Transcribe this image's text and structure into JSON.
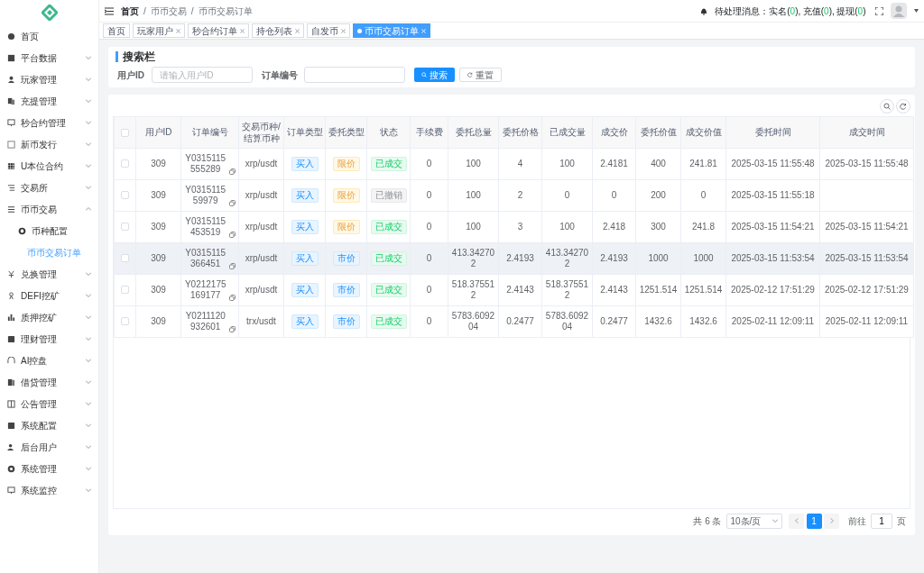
{
  "sidebar": {
    "items": [
      {
        "label": "首页",
        "has_children": false
      },
      {
        "label": "平台数据",
        "has_children": true,
        "expanded": false
      },
      {
        "label": "玩家管理",
        "has_children": true,
        "expanded": false
      },
      {
        "label": "充提管理",
        "has_children": true,
        "expanded": false
      },
      {
        "label": "秒合约管理",
        "has_children": true,
        "expanded": false
      },
      {
        "label": "新币发行",
        "has_children": true,
        "expanded": false
      },
      {
        "label": "U本位合约",
        "has_children": true,
        "expanded": false
      },
      {
        "label": "交易所",
        "has_children": true,
        "expanded": false
      },
      {
        "label": "币币交易",
        "has_children": true,
        "expanded": true,
        "children": [
          {
            "label": "币种配置",
            "selected": false,
            "icon": true
          },
          {
            "label": "币币交易订单",
            "selected": true,
            "icon": false
          }
        ]
      },
      {
        "label": "兑换管理",
        "has_children": true,
        "expanded": false
      },
      {
        "label": "DEFI挖矿",
        "has_children": true,
        "expanded": false
      },
      {
        "label": "质押挖矿",
        "has_children": true,
        "expanded": false
      },
      {
        "label": "理财管理",
        "has_children": true,
        "expanded": false
      },
      {
        "label": "AI控盘",
        "has_children": true,
        "expanded": false
      },
      {
        "label": "借贷管理",
        "has_children": true,
        "expanded": false
      },
      {
        "label": "公告管理",
        "has_children": true,
        "expanded": false
      },
      {
        "label": "系统配置",
        "has_children": true,
        "expanded": false
      },
      {
        "label": "后台用户",
        "has_children": true,
        "expanded": false
      },
      {
        "label": "系统管理",
        "has_children": true,
        "expanded": false
      },
      {
        "label": "系统监控",
        "has_children": true,
        "expanded": false
      }
    ]
  },
  "breadcrumb": {
    "separator": "/",
    "items": [
      "首页",
      "币币交易",
      "币币交易订单"
    ]
  },
  "notice": {
    "label": "待处理消息：",
    "items": [
      {
        "label": "实名(",
        "count": "0",
        "suffix": "),"
      },
      {
        "label": "充值(",
        "count": "0",
        "suffix": "),"
      },
      {
        "label": "提现(",
        "count": "0",
        "suffix": ")"
      }
    ]
  },
  "tabs": [
    {
      "label": "首页",
      "selected": false,
      "closable": false
    },
    {
      "label": "玩家用户",
      "selected": false,
      "closable": true
    },
    {
      "label": "秒合约订单",
      "selected": false,
      "closable": true
    },
    {
      "label": "持仓列表",
      "selected": false,
      "closable": true
    },
    {
      "label": "自发币",
      "selected": false,
      "closable": true
    },
    {
      "label": "币币交易订单",
      "selected": true,
      "closable": true
    }
  ],
  "search": {
    "title": "搜索栏",
    "fields": [
      {
        "label": "用户ID",
        "placeholder": "请输入用户ID"
      },
      {
        "label": "订单编号"
      }
    ],
    "search_button": "搜索",
    "reset_button": "重置"
  },
  "table": {
    "all_checked": false,
    "columns": [
      "用户ID",
      "订单编号",
      "交易币种/结算币种",
      "订单类型",
      "委托类型",
      "状态",
      "手续费",
      "委托总量",
      "委托价格",
      "已成交量",
      "成交价",
      "委托价值",
      "成交价值",
      "委托时间",
      "成交时间"
    ],
    "rows": [
      {
        "checked": false,
        "hovered": false,
        "user_id": "309",
        "order_no": "Y0315115555289",
        "pair": "xrp/usdt",
        "order_type": {
          "text": "买入",
          "kind": "buy"
        },
        "entrust_type": {
          "text": "限价",
          "kind": "limit"
        },
        "status": {
          "text": "已成交",
          "kind": "done"
        },
        "fee": "0",
        "total": "100",
        "price": "4",
        "filled": "100",
        "deal_price": "2.4181",
        "entrust_value": "400",
        "deal_value": "241.81",
        "entrust_time": "2025-03-15 11:55:48",
        "deal_time": "2025-03-15 11:55:48"
      },
      {
        "checked": false,
        "hovered": false,
        "user_id": "309",
        "order_no": "Y031511559979",
        "pair": "xrp/usdt",
        "order_type": {
          "text": "买入",
          "kind": "buy"
        },
        "entrust_type": {
          "text": "限价",
          "kind": "limit"
        },
        "status": {
          "text": "已撤销",
          "kind": "cancelled"
        },
        "fee": "0",
        "total": "100",
        "price": "2",
        "filled": "0",
        "deal_price": "0",
        "entrust_value": "200",
        "deal_value": "0",
        "entrust_time": "2025-03-15 11:55:18"
      },
      {
        "checked": false,
        "hovered": false,
        "user_id": "309",
        "order_no": "Y0315115453519",
        "pair": "xrp/usdt",
        "order_type": {
          "text": "买入",
          "kind": "buy"
        },
        "entrust_type": {
          "text": "限价",
          "kind": "limit"
        },
        "status": {
          "text": "已成交",
          "kind": "done"
        },
        "fee": "0",
        "total": "100",
        "price": "3",
        "filled": "100",
        "deal_price": "2.418",
        "entrust_value": "300",
        "deal_value": "241.8",
        "entrust_time": "2025-03-15 11:54:21",
        "deal_time": "2025-03-15 11:54:21"
      },
      {
        "checked": false,
        "hovered": true,
        "user_id": "309",
        "order_no": "Y0315115366451",
        "pair": "xrp/usdt",
        "order_type": {
          "text": "买入",
          "kind": "buy"
        },
        "entrust_type": {
          "text": "市价",
          "kind": "market"
        },
        "status": {
          "text": "已成交",
          "kind": "done"
        },
        "fee": "0",
        "total": "413.342702",
        "price": "2.4193",
        "filled": "413.342702",
        "deal_price": "2.4193",
        "entrust_value": "1000",
        "deal_value": "1000",
        "entrust_time": "2025-03-15 11:53:54",
        "deal_time": "2025-03-15 11:53:54"
      },
      {
        "checked": false,
        "hovered": false,
        "user_id": "309",
        "order_no": "Y0212175169177",
        "pair": "xrp/usdt",
        "order_type": {
          "text": "买入",
          "kind": "buy"
        },
        "entrust_type": {
          "text": "市价",
          "kind": "market"
        },
        "status": {
          "text": "已成交",
          "kind": "done"
        },
        "fee": "0",
        "total": "518.375512",
        "price": "2.4143",
        "filled": "518.375512",
        "deal_price": "2.4143",
        "entrust_value": "1251.514",
        "deal_value": "1251.514",
        "entrust_time": "2025-02-12 17:51:29",
        "deal_time": "2025-02-12 17:51:29"
      },
      {
        "checked": false,
        "hovered": false,
        "user_id": "309",
        "order_no": "Y0211120932601",
        "pair": "trx/usdt",
        "order_type": {
          "text": "买入",
          "kind": "buy"
        },
        "entrust_type": {
          "text": "市价",
          "kind": "market"
        },
        "status": {
          "text": "已成交",
          "kind": "done"
        },
        "fee": "0",
        "total": "5783.609204",
        "price": "0.2477",
        "filled": "5783.609204",
        "deal_price": "0.2477",
        "entrust_value": "1432.6",
        "deal_value": "1432.6",
        "entrust_time": "2025-02-11 12:09:11",
        "deal_time": "2025-02-11 12:09:11"
      }
    ]
  },
  "pagination": {
    "total": "共 6 条",
    "page_size": "10条/页",
    "pages": [
      {
        "label": "1",
        "selected": true
      }
    ],
    "goto_label": "前往",
    "goto_value": "1",
    "goto_suffix": "页"
  }
}
